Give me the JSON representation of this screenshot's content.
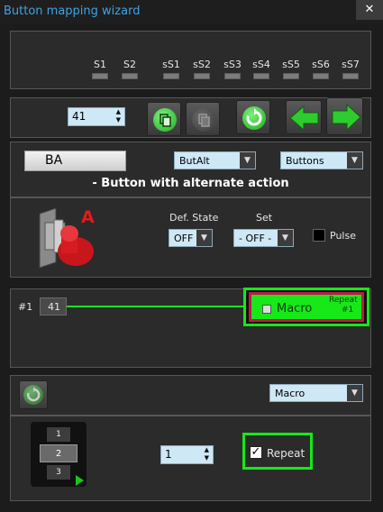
{
  "window": {
    "title": "Button mapping wizard",
    "close": "✕"
  },
  "slots": [
    "S1",
    "S2",
    "sS1",
    "sS2",
    "sS3",
    "sS4",
    "sS5",
    "sS6",
    "sS7"
  ],
  "toolbar": {
    "button_number": "41",
    "copy_icon": "copy-icon",
    "paste_icon": "paste-icon",
    "refresh_icon": "refresh-icon",
    "prev_icon": "arrow-left-icon",
    "next_icon": "arrow-right-icon"
  },
  "button_config": {
    "name": "BA",
    "type_select": "ButAlt",
    "category_select": "Buttons",
    "description": "- Button with alternate action",
    "badge": "A",
    "def_state_label": "Def. State",
    "def_state_value": "OFF",
    "set_label": "Set",
    "set_value": "- OFF -",
    "pulse_label": "Pulse"
  },
  "mapping": {
    "index": "#1",
    "value": "41",
    "macro_label": "Macro",
    "repeat_label": "Repeat",
    "repeat_hash": "#1"
  },
  "macro_panel": {
    "action_select": "Macro",
    "repeat_value": "1",
    "repeat_label": "Repeat",
    "repeat_checked": true,
    "steps": [
      "1",
      "2",
      "3"
    ]
  },
  "colors": {
    "accent_green": "#17e817",
    "title_blue": "#3ca3e6",
    "highlight_red": "#c0184a",
    "badge_red": "#e21b1b"
  }
}
